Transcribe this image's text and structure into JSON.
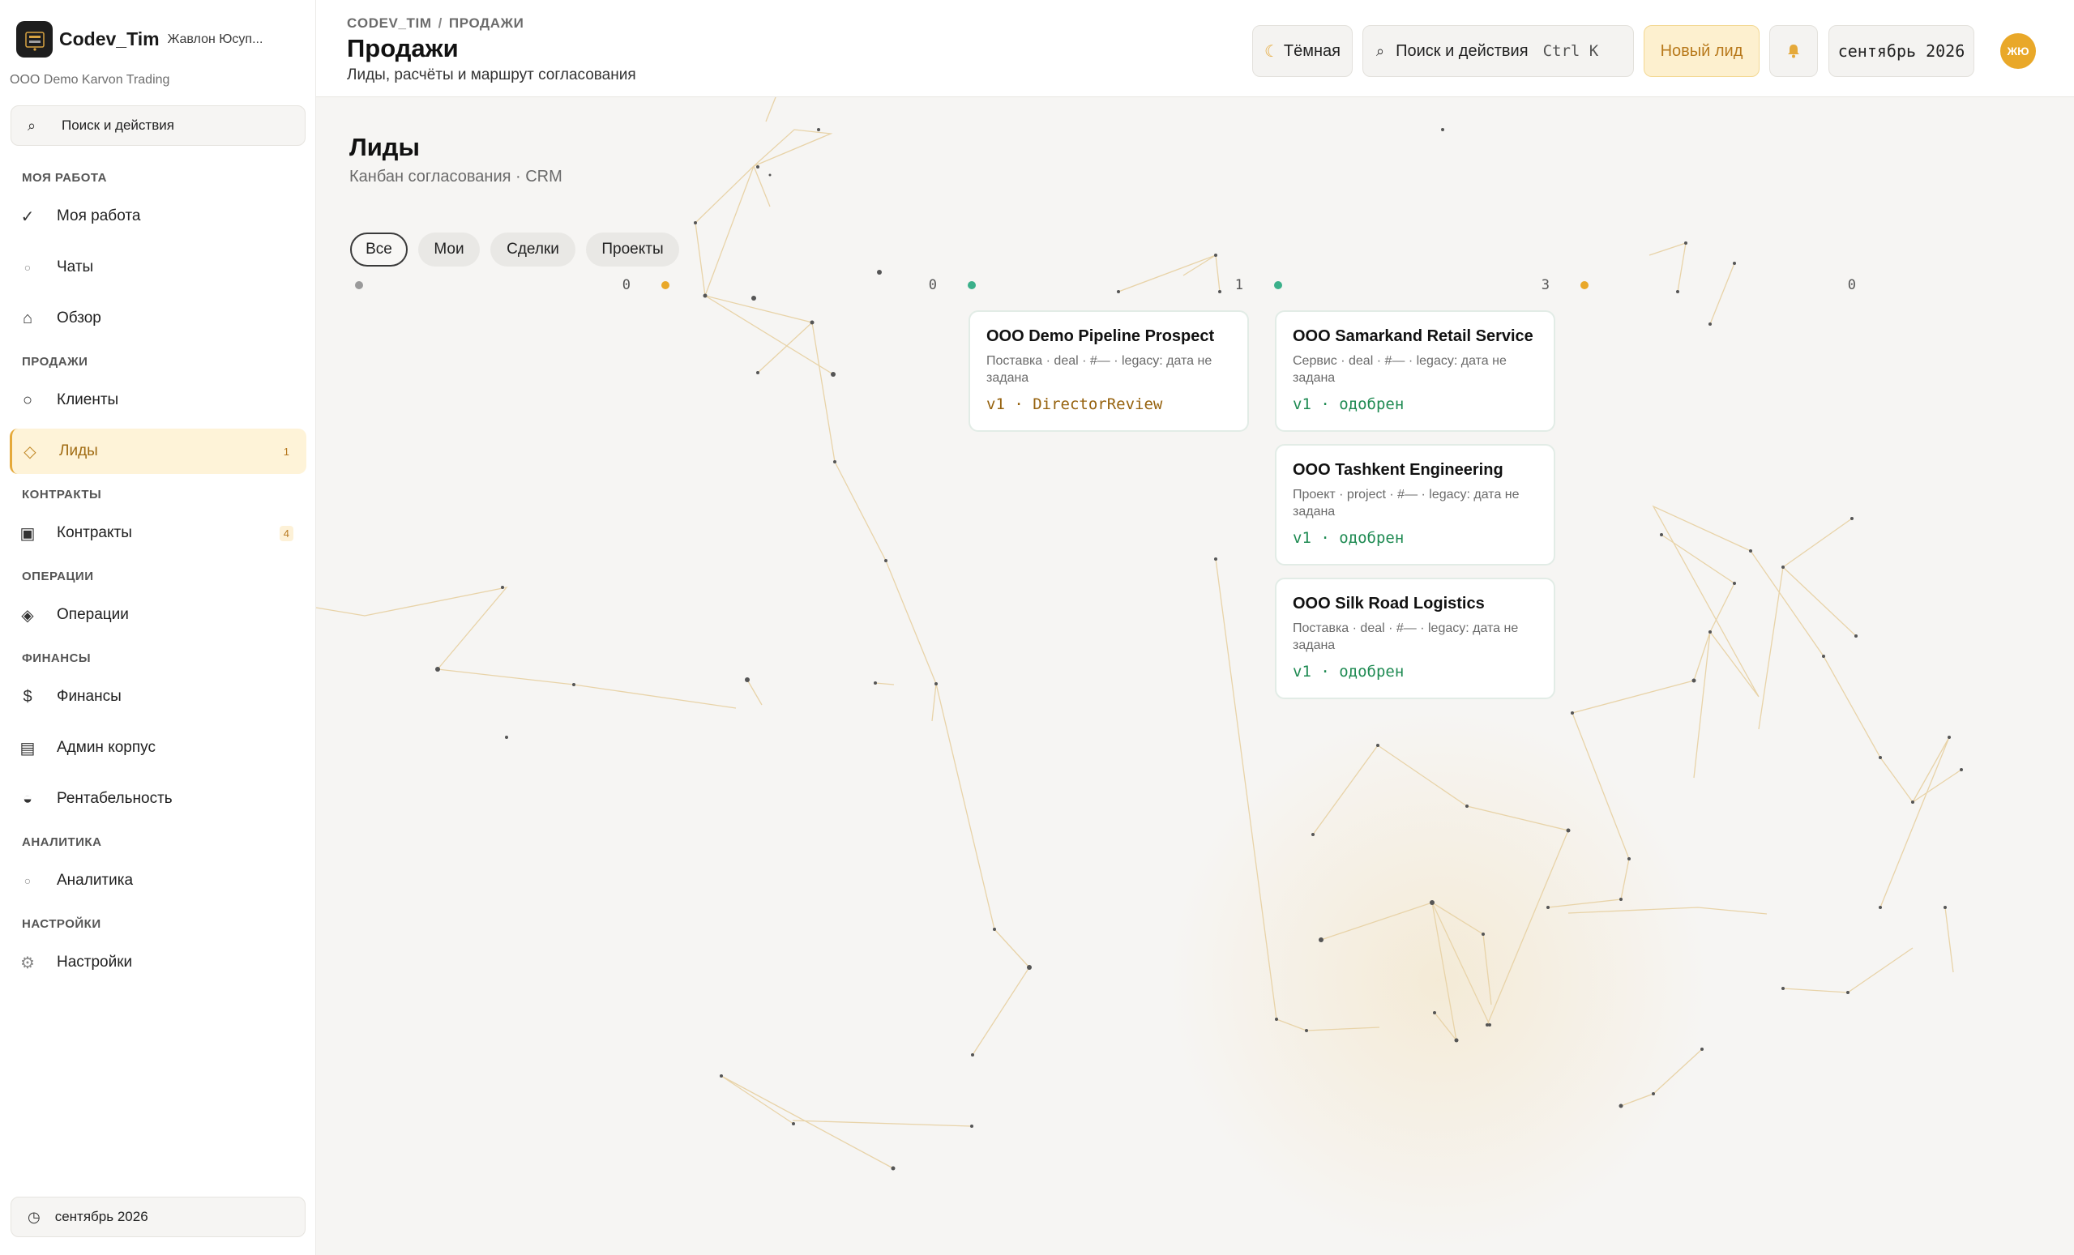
{
  "brand": {
    "name": "Codev_Tim",
    "user": "Жавлон Юсуп...",
    "org": "OOO Demo Karvon Trading"
  },
  "sidebar": {
    "search_label": "Поиск и действия",
    "sections": {
      "my_work": "МОЯ РАБОТА",
      "sales": "ПРОДАЖИ",
      "contracts": "КОНТРАКТЫ",
      "operations": "ОПЕРАЦИИ",
      "finance": "ФИНАНСЫ",
      "analytics": "АНАЛИТИКА",
      "settings": "НАСТРОЙКИ"
    },
    "items": [
      {
        "label": "Моя работа",
        "icon": "check-icon"
      },
      {
        "label": "Чаты",
        "icon": "chat-icon"
      },
      {
        "label": "Обзор",
        "icon": "home-icon"
      },
      {
        "label": "Клиенты",
        "icon": "circle-icon"
      },
      {
        "label": "Лиды",
        "icon": "diamond-icon",
        "badge": "1",
        "active": true
      },
      {
        "label": "Контракты",
        "icon": "square-icon",
        "badge": "4"
      },
      {
        "label": "Операции",
        "icon": "diamond-filled-icon"
      },
      {
        "label": "Финансы",
        "icon": "dollar-icon"
      },
      {
        "label": "Админ корпус",
        "icon": "list-icon"
      },
      {
        "label": "Рентабельность",
        "icon": "half-circle-icon"
      },
      {
        "label": "Аналитика",
        "icon": "circle-small-icon"
      },
      {
        "label": "Настройки",
        "icon": "gear-icon"
      }
    ],
    "footer_date": "сентябрь 2026"
  },
  "header": {
    "breadcrumb": [
      "CODEV_TIM",
      "ПРОДАЖИ"
    ],
    "breadcrumb_sep": "/",
    "title": "Продажи",
    "subtitle": "Лиды, расчёты и маршрут согласования",
    "theme_label": "Тёмная",
    "search_label": "Поиск и действия",
    "search_shortcut": "Ctrl K",
    "new_lead_label": "Новый лид",
    "date_label": "сентябрь 2026",
    "avatar_initials": "ЖЮ"
  },
  "page": {
    "title": "Лиды",
    "subtitle": "Канбан согласования · CRM",
    "filters": [
      "Все",
      "Мои",
      "Сделки",
      "Проекты"
    ],
    "active_filter": "Все"
  },
  "kanban": {
    "columns": [
      {
        "count": "0",
        "color": "#9a9a9a",
        "cards": []
      },
      {
        "count": "0",
        "color": "#e9a829",
        "cards": []
      },
      {
        "count": "1",
        "color": "#3bb08a",
        "cards": [
          {
            "title": "OOO Demo Pipeline Prospect",
            "meta": "Поставка · deal · #— · legacy: дата не задана",
            "status": "v1 · DirectorReview"
          }
        ]
      },
      {
        "count": "3",
        "color": "#3bb08a",
        "cards": [
          {
            "title": "OOO Samarkand Retail Service",
            "meta": "Сервис · deal · #— · legacy: дата не задана",
            "status": "v1 · одобрен"
          },
          {
            "title": "OOO Tashkent Engineering",
            "meta": "Проект · project · #— · legacy: дата не задана",
            "status": "v1 · одобрен"
          },
          {
            "title": "OOO Silk Road Logistics",
            "meta": "Поставка · deal · #— · legacy: дата не задана",
            "status": "v1 · одобрен"
          }
        ]
      },
      {
        "count": "0",
        "color": "#e9a829",
        "cards": []
      }
    ]
  },
  "colors": {
    "accent": "#e9a829",
    "approved": "#1e8a52",
    "review": "#96620e"
  }
}
